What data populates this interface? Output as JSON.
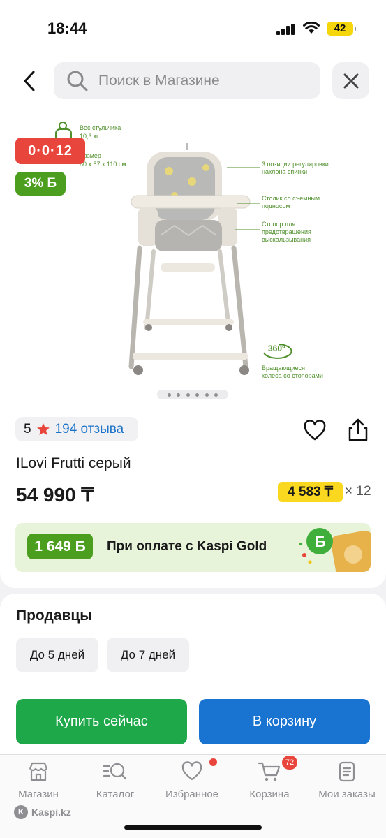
{
  "status_bar": {
    "time": "18:44",
    "battery": "42"
  },
  "header": {
    "search_placeholder": "Поиск в Магазине"
  },
  "gallery": {
    "timer_badge": "0·0·12",
    "bonus_badge": "3% Б",
    "dots_count": 6,
    "annotations": {
      "weight_title": "Вес стульчика",
      "weight_value": "10,3 кг",
      "size_title": "Размер",
      "size_value": "80 x 57 x 110 см",
      "back_positions_1": "3 позиции регулировки",
      "back_positions_2": "наклона спинки",
      "tray_1": "Столик со съемным",
      "tray_2": "подносом",
      "stopper_1": "Стопор для",
      "stopper_2": "предотвращения",
      "stopper_3": "выскальзывания",
      "rotate_deg": "360°",
      "wheels_1": "Вращающиеся",
      "wheels_2": "колеса со стопорами"
    }
  },
  "product": {
    "rating": "5",
    "reviews": "194 отзыва",
    "title": "ILovi Frutti серый",
    "price": "54 990 ₸",
    "installment": "4 583 ₸",
    "installment_mult": "× 12"
  },
  "kaspi_gold": {
    "bonus": "1 649 Б",
    "text": "При оплате с Kaspi Gold"
  },
  "sellers": {
    "title": "Продавцы",
    "filters": [
      "До 5 дней",
      "До 7 дней"
    ],
    "buy_now": "Купить сейчас",
    "add_to_cart": "В корзину"
  },
  "tabbar": {
    "items": [
      "Магазин",
      "Каталог",
      "Избранное",
      "Корзина",
      "Мои заказы"
    ],
    "cart_count": "72"
  },
  "footer": {
    "logo_text": "Kaspi.kz"
  },
  "colors": {
    "kaspi_red": "#e8453c",
    "bonus_green": "#4c9e1e",
    "buy_green": "#1fa84a",
    "cart_blue": "#1873d1",
    "installment_yellow": "#fad81f"
  }
}
